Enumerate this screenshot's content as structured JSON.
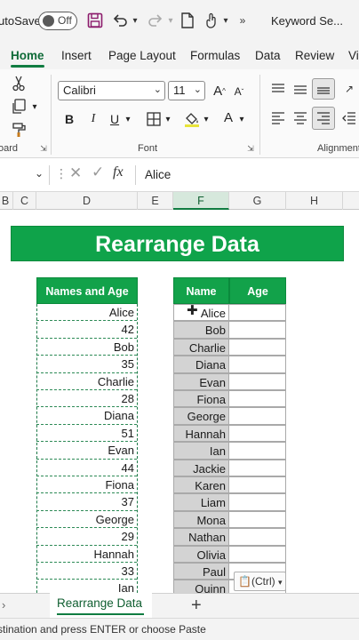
{
  "titlebar": {
    "autosave_label": "utoSave",
    "toggle_state": "Off",
    "search_text": "Keyword Se..."
  },
  "ribbon_tabs": [
    "Home",
    "Insert",
    "Page Layout",
    "Formulas",
    "Data",
    "Review",
    "Vi"
  ],
  "ribbon": {
    "font_name": "Calibri",
    "font_size": "11",
    "bold": "B",
    "italic": "I",
    "underline": "U",
    "group_clipboard": "oard",
    "group_font": "Font",
    "group_alignment": "Alignment"
  },
  "formula_bar": {
    "fx_label": "fx",
    "value": "Alice"
  },
  "columns": [
    "B",
    "C",
    "D",
    "E",
    "F",
    "G",
    "H"
  ],
  "sheet": {
    "banner": "Rearrange Data",
    "list_header": "Names and Age",
    "list_values": [
      "Alice",
      "42",
      "Bob",
      "35",
      "Charlie",
      "28",
      "Diana",
      "51",
      "Evan",
      "44",
      "Fiona",
      "37",
      "George",
      "29",
      "Hannah",
      "33",
      "Ian"
    ],
    "table_headers": [
      "Name",
      "Age"
    ],
    "names": [
      "Alice",
      "Bob",
      "Charlie",
      "Diana",
      "Evan",
      "Fiona",
      "George",
      "Hannah",
      "Ian",
      "Jackie",
      "Karen",
      "Liam",
      "Mona",
      "Nathan",
      "Olivia",
      "Paul",
      "Quinn"
    ],
    "paste_label": "(Ctrl)"
  },
  "sheet_tabs": {
    "active": "Rearrange Data",
    "add": "+"
  },
  "status": "stination and press ENTER or choose Paste",
  "colors": {
    "accent": "#107c41",
    "header_green": "#12a24a",
    "selection_gray": "#d3d3d3"
  }
}
